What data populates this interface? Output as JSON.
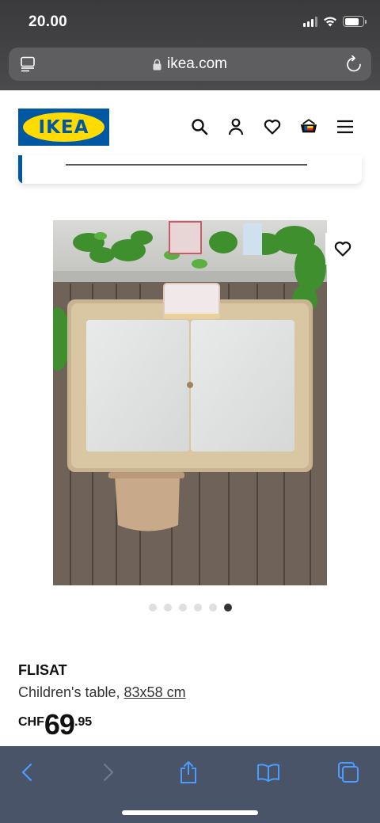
{
  "status_bar": {
    "time": "20.00"
  },
  "browser": {
    "url": "ikea.com"
  },
  "site": {
    "logo_text": "IKEA"
  },
  "header_icons": [
    "search-icon",
    "account-icon",
    "favourites-icon",
    "cart-icon",
    "menu-icon"
  ],
  "gallery": {
    "image_count": 6,
    "active_index": 5
  },
  "product": {
    "name": "FLISAT",
    "type": "Children's table,",
    "dimensions": "83x58 cm",
    "currency": "CHF",
    "price_integer": "69",
    "price_decimal": ".95"
  },
  "colors": {
    "ikea_blue": "#0058a3",
    "ikea_yellow": "#ffdb00"
  }
}
